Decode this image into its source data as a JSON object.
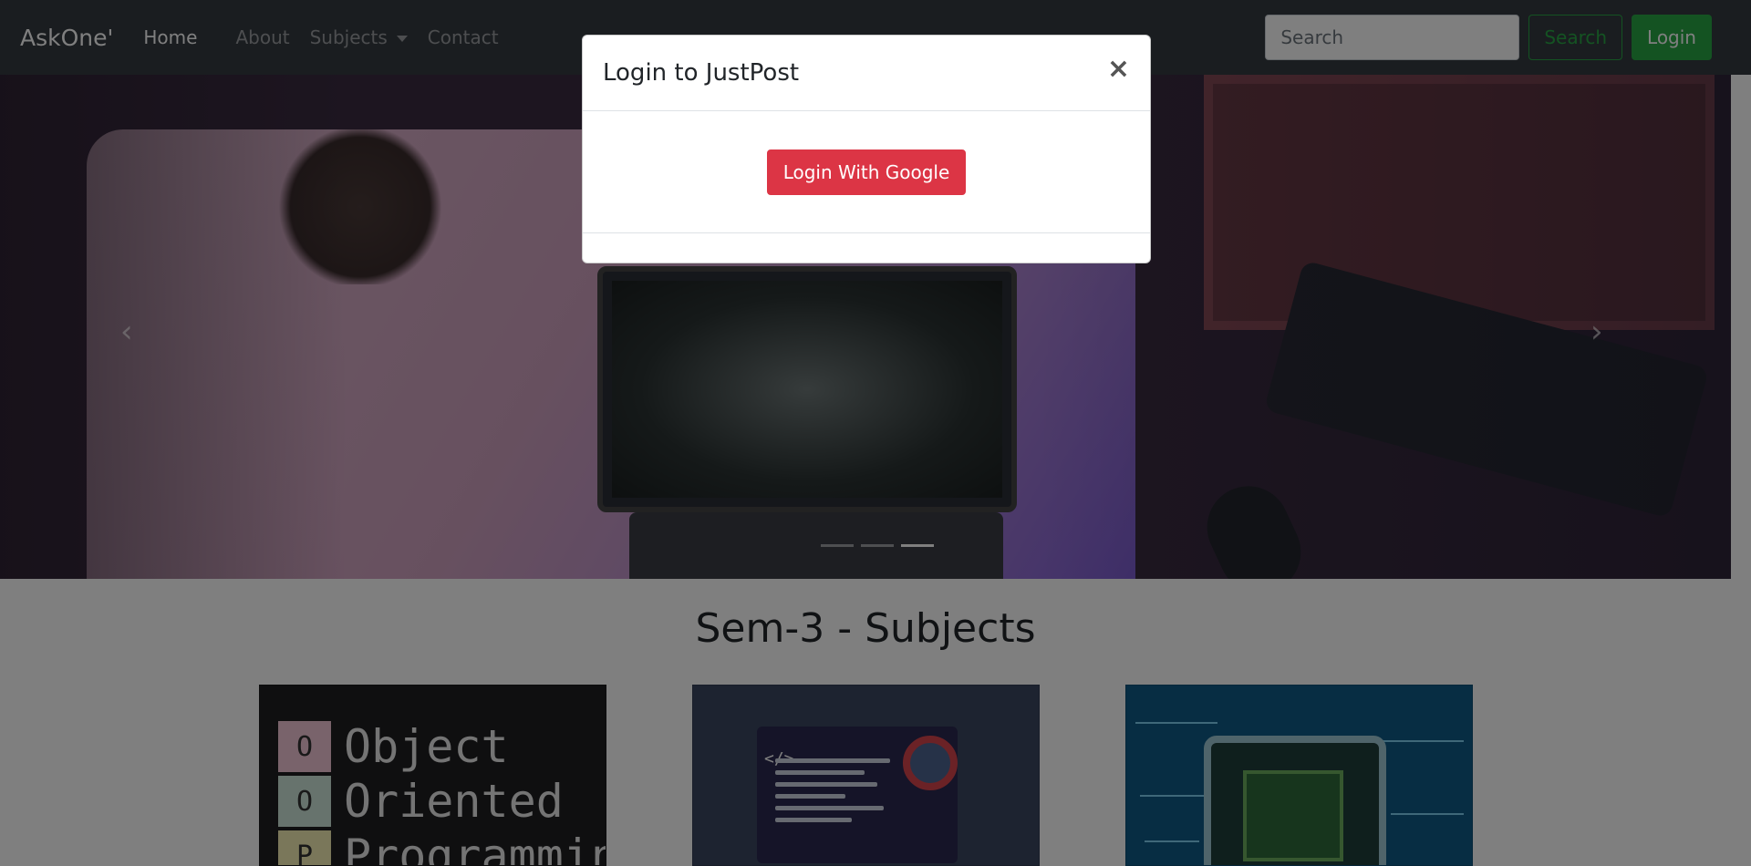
{
  "navbar": {
    "brand": "AskOne'",
    "links": {
      "home": "Home",
      "about": "About",
      "subjects": "Subjects",
      "contact": "Contact"
    },
    "search_placeholder": "Search",
    "search_button": "Search",
    "login_button": "Login"
  },
  "carousel": {
    "prev_icon": "chevron-left-icon",
    "next_icon": "chevron-right-icon",
    "prev_glyph": "‹",
    "next_glyph": "›",
    "slides": 3,
    "active_slide": 2
  },
  "main": {
    "section_title": "Sem-3 - Subjects",
    "cards": [
      {
        "image_name": "oop-image",
        "image_text": [
          "O",
          "O",
          "P"
        ],
        "image_words": [
          "Object",
          "Oriented",
          "Programming"
        ]
      },
      {
        "image_name": "web-development-image",
        "image_symbol": "</>"
      },
      {
        "image_name": "processor-chip-image"
      }
    ]
  },
  "modal": {
    "title": "Login to JustPost",
    "close_glyph": "×",
    "google_button": "Login With Google"
  },
  "colors": {
    "navbar_bg": "#343a40",
    "success": "#28a745",
    "danger": "#dc3545"
  }
}
